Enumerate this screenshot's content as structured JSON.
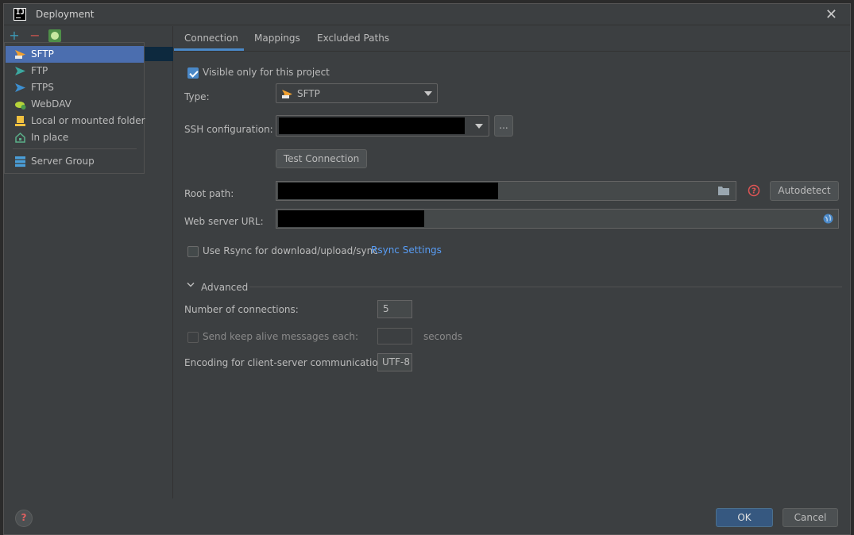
{
  "window": {
    "title": "Deployment"
  },
  "toolbar": {
    "add": "+",
    "remove": "−"
  },
  "popup": {
    "items": [
      {
        "label": "SFTP",
        "icon": "sftp-icon"
      },
      {
        "label": "FTP",
        "icon": "ftp-icon"
      },
      {
        "label": "FTPS",
        "icon": "ftps-icon"
      },
      {
        "label": "WebDAV",
        "icon": "webdav-icon"
      },
      {
        "label": "Local or mounted folder",
        "icon": "local-folder-icon"
      },
      {
        "label": "In place",
        "icon": "in-place-icon"
      },
      {
        "label": "Server Group",
        "icon": "server-group-icon"
      }
    ],
    "selected": "SFTP"
  },
  "tabs": [
    "Connection",
    "Mappings",
    "Excluded Paths"
  ],
  "form": {
    "visible_only_label": "Visible only for this project",
    "visible_only_checked": true,
    "type_label": "Type:",
    "type_value": "SFTP",
    "ssh_label": "SSH configuration:",
    "ssh_browse": "...",
    "test_connection": "Test Connection",
    "root_path_label": "Root path:",
    "autodetect": "Autodetect",
    "web_url_label": "Web server URL:",
    "rsync_label": "Use Rsync for download/upload/sync",
    "rsync_settings": "Rsync Settings",
    "advanced_label": "Advanced",
    "connections_label": "Number of connections:",
    "connections_value": "5",
    "keepalive_label": "Send keep alive messages each:",
    "keepalive_unit": "seconds",
    "encoding_label": "Encoding for client-server communication:",
    "encoding_value": "UTF-8"
  },
  "footer": {
    "ok": "OK",
    "cancel": "Cancel"
  },
  "colors": {
    "accent": "#4a88c7",
    "selection": "#4b6eaf",
    "link": "#589df6"
  }
}
